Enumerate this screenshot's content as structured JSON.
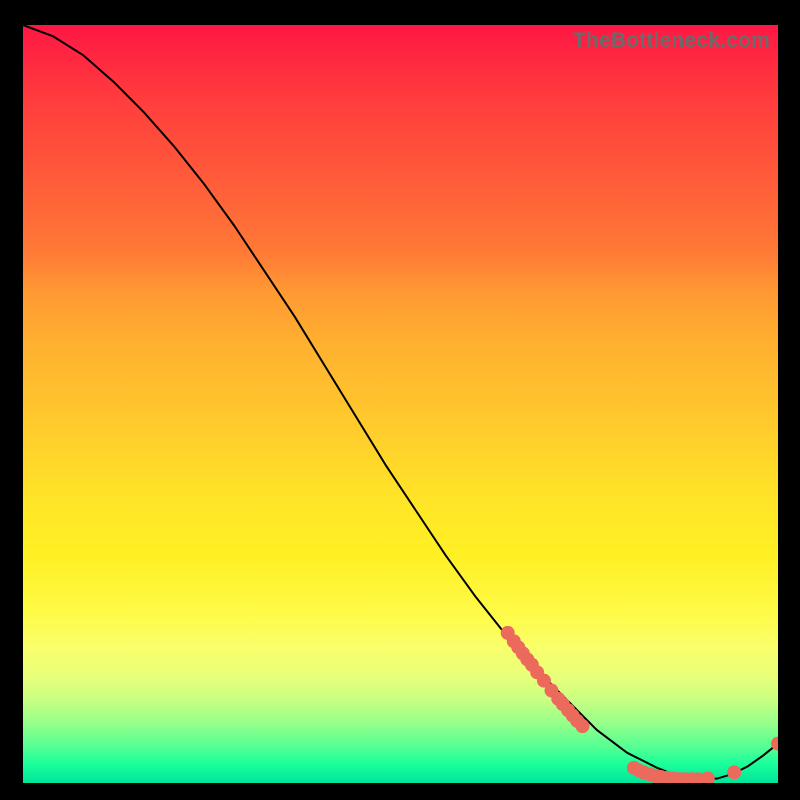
{
  "watermark": "TheBottleneck.com",
  "chart_data": {
    "type": "line",
    "title": "",
    "xlabel": "",
    "ylabel": "",
    "xlim": [
      0,
      100
    ],
    "ylim": [
      0,
      100
    ],
    "grid": false,
    "series": [
      {
        "name": "bottleneck-curve",
        "color": "#000000",
        "x": [
          0,
          4,
          8,
          12,
          16,
          20,
          24,
          28,
          32,
          36,
          40,
          44,
          48,
          52,
          56,
          60,
          64,
          68,
          70,
          72,
          74,
          76,
          78,
          80,
          82,
          84,
          86,
          88,
          90,
          92,
          94,
          96,
          98,
          100
        ],
        "y": [
          100.0,
          98.5,
          96.0,
          92.5,
          88.5,
          84.0,
          79.0,
          73.5,
          67.5,
          61.5,
          55.0,
          48.5,
          42.0,
          36.0,
          30.0,
          24.5,
          19.5,
          15.0,
          13.0,
          11.0,
          9.0,
          7.0,
          5.5,
          4.0,
          3.0,
          2.0,
          1.2,
          0.7,
          0.5,
          0.6,
          1.2,
          2.2,
          3.6,
          5.2
        ]
      },
      {
        "name": "markers",
        "type": "scatter",
        "color": "#ec6a5c",
        "points": [
          {
            "x": 64.2,
            "y": 19.8
          },
          {
            "x": 65.0,
            "y": 18.7
          },
          {
            "x": 65.6,
            "y": 17.9
          },
          {
            "x": 66.2,
            "y": 17.1
          },
          {
            "x": 66.8,
            "y": 16.3
          },
          {
            "x": 67.4,
            "y": 15.6
          },
          {
            "x": 68.1,
            "y": 14.6
          },
          {
            "x": 69.0,
            "y": 13.5
          },
          {
            "x": 70.0,
            "y": 12.2
          },
          {
            "x": 70.9,
            "y": 11.1
          },
          {
            "x": 71.5,
            "y": 10.4
          },
          {
            "x": 72.2,
            "y": 9.6
          },
          {
            "x": 72.8,
            "y": 8.9
          },
          {
            "x": 73.4,
            "y": 8.2
          },
          {
            "x": 74.1,
            "y": 7.5
          },
          {
            "x": 80.9,
            "y": 2.0
          },
          {
            "x": 81.5,
            "y": 1.7
          },
          {
            "x": 82.2,
            "y": 1.4
          },
          {
            "x": 83.1,
            "y": 1.1
          },
          {
            "x": 83.8,
            "y": 0.9
          },
          {
            "x": 84.5,
            "y": 0.8
          },
          {
            "x": 85.4,
            "y": 0.7
          },
          {
            "x": 86.2,
            "y": 0.6
          },
          {
            "x": 87.0,
            "y": 0.5
          },
          {
            "x": 87.8,
            "y": 0.5
          },
          {
            "x": 88.6,
            "y": 0.5
          },
          {
            "x": 89.4,
            "y": 0.5
          },
          {
            "x": 90.7,
            "y": 0.6
          },
          {
            "x": 94.2,
            "y": 1.4
          },
          {
            "x": 100.0,
            "y": 5.2
          }
        ]
      }
    ]
  }
}
